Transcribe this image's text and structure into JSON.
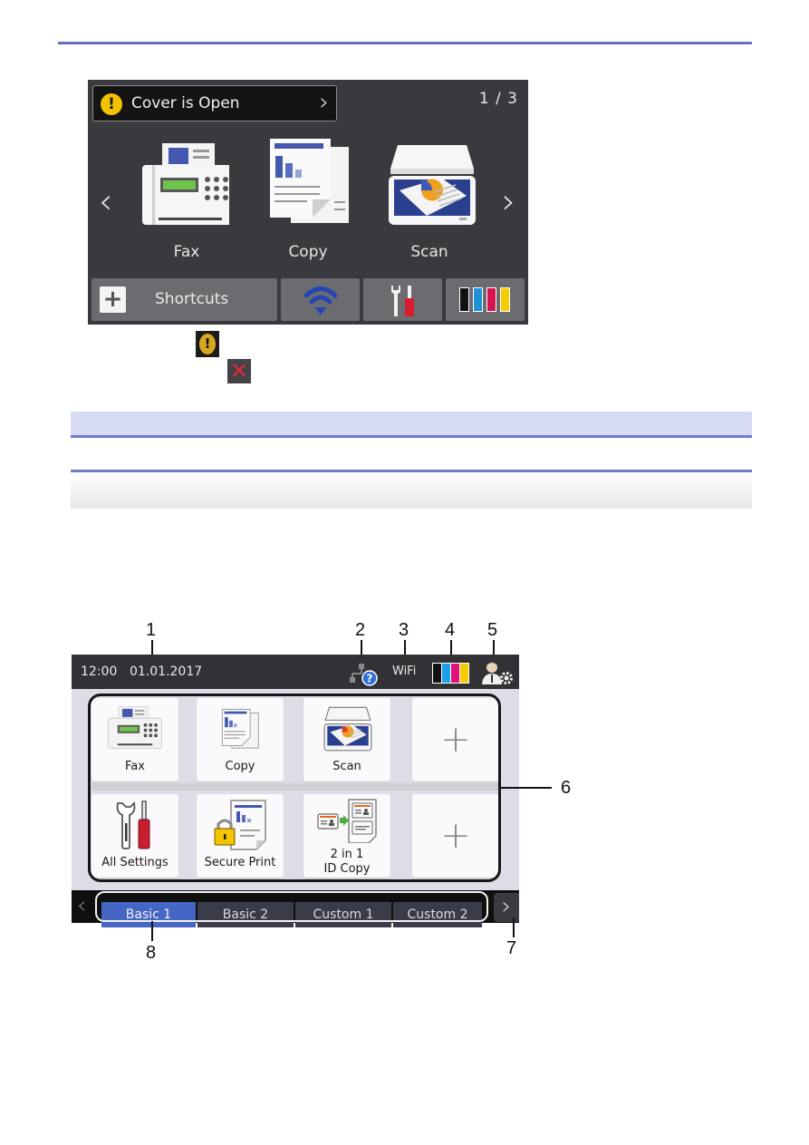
{
  "screen1": {
    "alert": {
      "icon": "!",
      "message": "Cover is Open",
      "chevron": "›"
    },
    "page_counter": "1 / 3",
    "nav": {
      "prev": "‹",
      "next": "›"
    },
    "functions": [
      {
        "label": "Fax",
        "icon": "fax-icon"
      },
      {
        "label": "Copy",
        "icon": "copy-icon"
      },
      {
        "label": "Scan",
        "icon": "scan-icon"
      }
    ],
    "bottom_bar": {
      "shortcuts_label": "Shortcuts",
      "shortcuts_plus": "+",
      "wifi_icon": "wifi-icon",
      "settings_icon": "settings-icon",
      "ink_icon": "ink-icon"
    }
  },
  "inline_icons": {
    "warning_glyph": "!",
    "error_glyph": "✕"
  },
  "colors": {
    "ink_black": "#111111",
    "ink_cyan": "#1e90d6",
    "ink_magenta": "#d6124f",
    "ink_yellow": "#f4cc00",
    "accent_rule": "#6470c0",
    "active_tab": "#4566c4",
    "warning": "#f2c200",
    "error": "#e0283a"
  },
  "screen2": {
    "status": {
      "time": "12:00",
      "date": "01.01.2017",
      "wifi_label": "WiFi",
      "network_glyph": "?"
    },
    "tiles": [
      {
        "label": "Fax"
      },
      {
        "label": "Copy"
      },
      {
        "label": "Scan"
      },
      {
        "label": "+"
      },
      {
        "label": "All Settings"
      },
      {
        "label": "Secure Print"
      },
      {
        "label": "2 in 1",
        "label2": "ID Copy"
      },
      {
        "label": "+"
      }
    ],
    "tabs": [
      {
        "label": "Basic 1",
        "active": true
      },
      {
        "label": "Basic 2",
        "active": false
      },
      {
        "label": "Custom 1",
        "active": false
      },
      {
        "label": "Custom 2",
        "active": false
      }
    ],
    "nav": {
      "prev": "‹",
      "next": "›"
    }
  },
  "callouts": [
    "1",
    "2",
    "3",
    "4",
    "5",
    "6",
    "7",
    "8"
  ]
}
